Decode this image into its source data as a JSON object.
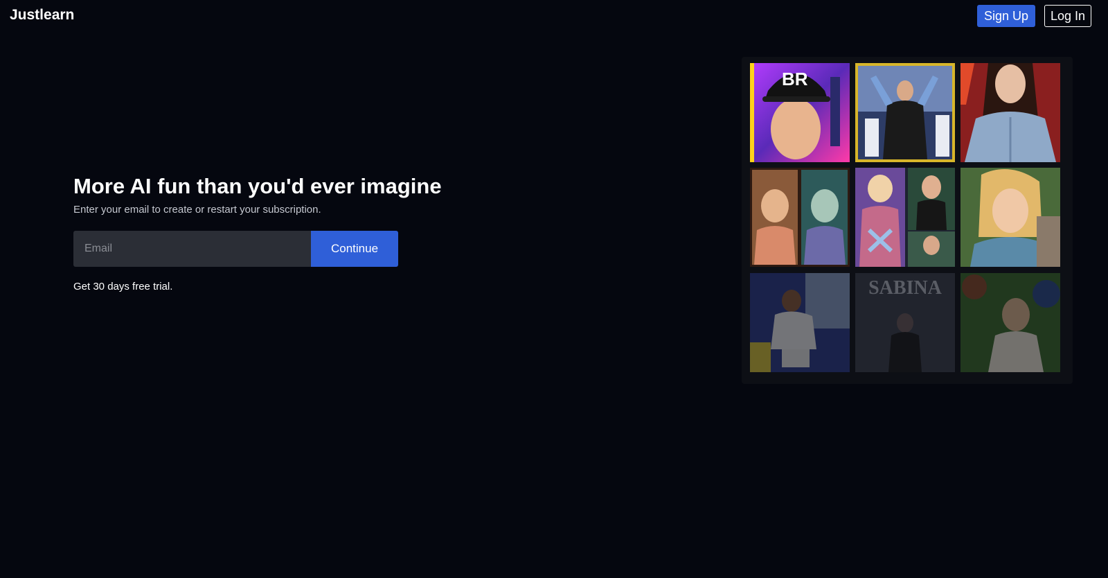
{
  "header": {
    "logo": "Justlearn",
    "signup_label": "Sign Up",
    "login_label": "Log In"
  },
  "hero": {
    "title": "More AI fun than you'd ever imagine",
    "subtitle": "Enter your email to create or restart your subscription.",
    "email_placeholder": "Email",
    "continue_label": "Continue",
    "trial_text": "Get 30 days free trial."
  },
  "gallery": {
    "tile_8_text": "SABINA"
  },
  "colors": {
    "background": "#05070f",
    "accent": "#2f5fd8",
    "input_bg": "#2b2e36"
  }
}
